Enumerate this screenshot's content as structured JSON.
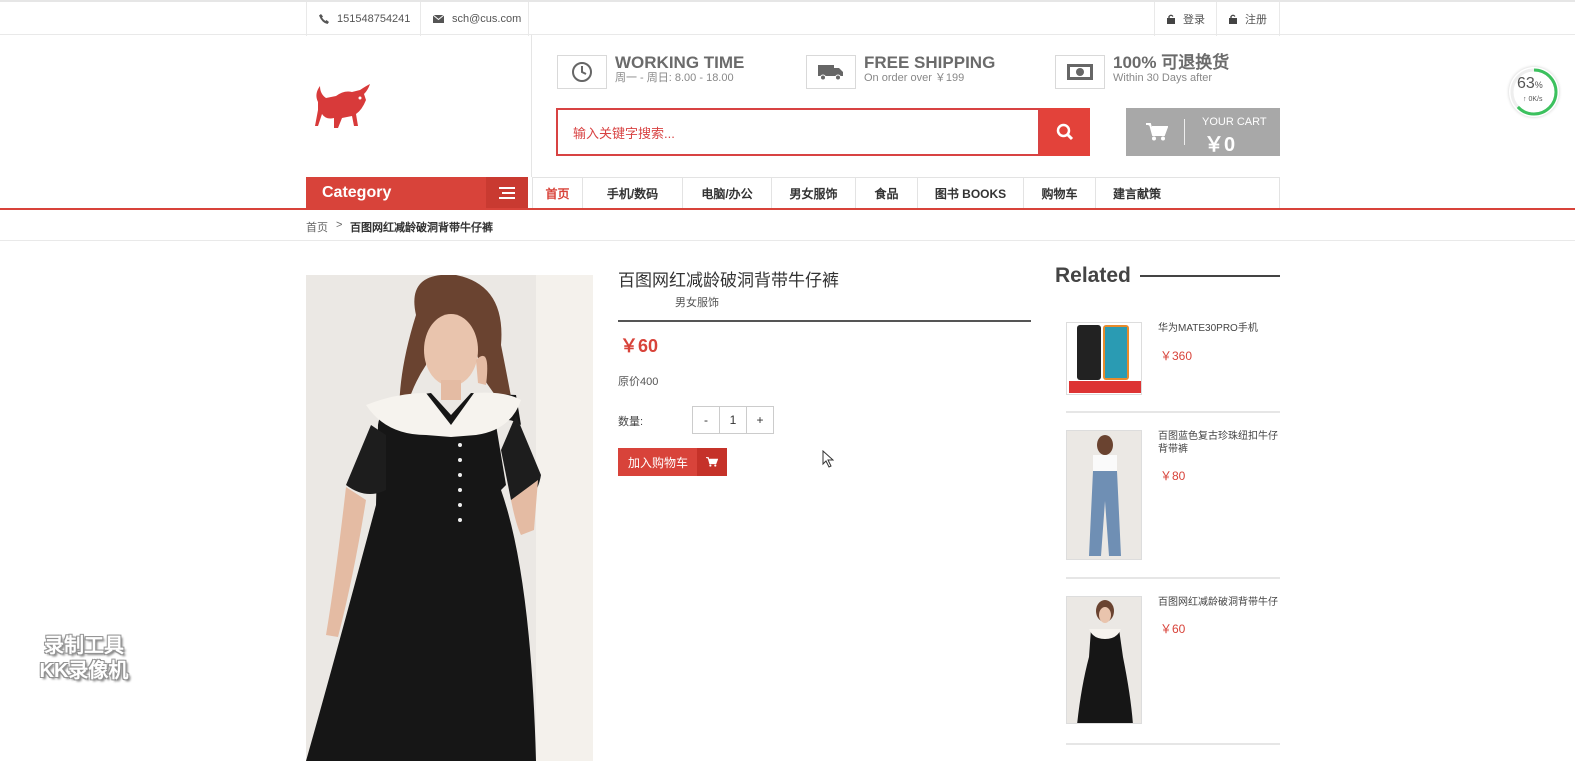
{
  "topbar": {
    "phone": "151548754241",
    "email": "sch@cus.com",
    "login": "登录",
    "register": "注册"
  },
  "features": [
    {
      "icon": "clock-icon",
      "title": "WORKING TIME",
      "subtitle": "周一 - 周日: 8.00 - 18.00"
    },
    {
      "icon": "truck-icon",
      "title": "FREE SHIPPING",
      "subtitle": "On order over ￥199"
    },
    {
      "icon": "money-icon",
      "title": "100% 可退换货",
      "subtitle": "Within 30 Days after"
    }
  ],
  "search": {
    "placeholder": "输入关键字搜索..."
  },
  "cart": {
    "label": "YOUR CART",
    "amount": "￥0"
  },
  "category": {
    "label": "Category"
  },
  "nav": {
    "items": [
      "首页",
      "手机/数码",
      "电脑/办公",
      "男女服饰",
      "食品",
      "图书 BOOKS",
      "购物车",
      "建言献策"
    ],
    "active_index": 0
  },
  "breadcrumb": {
    "home": "首页",
    "separator": ">",
    "current": "百图网红减龄破洞背带牛仔裤"
  },
  "product": {
    "title": "百图网红减龄破洞背带牛仔裤",
    "category": "男女服饰",
    "price": "￥60",
    "original_price": "原价400",
    "quantity_label": "数量:",
    "minus": "-",
    "quantity": "1",
    "plus": "+",
    "add_to_cart": "加入购物车"
  },
  "related": {
    "title": "Related",
    "items": [
      {
        "name": "华为MATE30PRO手机",
        "price": "￥360"
      },
      {
        "name": "百图蓝色复古珍珠纽扣牛仔背带裤",
        "price": "￥80"
      },
      {
        "name": "百图网红减龄破洞背带牛仔裤",
        "price": "￥60"
      }
    ]
  },
  "speed_widget": {
    "percent": "63",
    "percent_sign": "%",
    "rate": "↑ 0K/s"
  },
  "watermark": {
    "line1": "录制工具",
    "line2": "KK录像机"
  },
  "colors": {
    "accent": "#d8433a",
    "cart_bg": "#a8a8a8"
  }
}
